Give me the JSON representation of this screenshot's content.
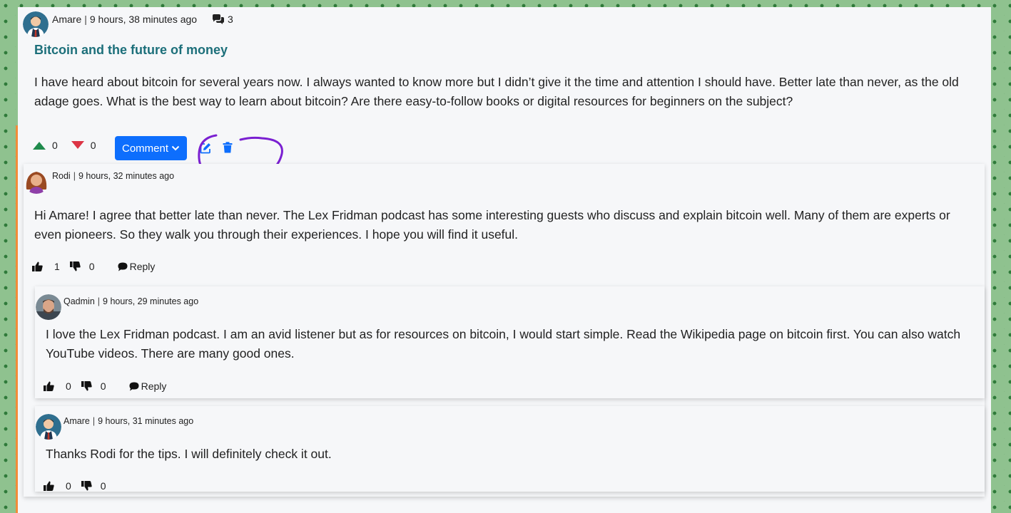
{
  "post": {
    "author": "Amare",
    "time": "9 hours, 38 minutes ago",
    "comment_count": "3",
    "title": "Bitcoin and the future of money",
    "body": "I have heard about bitcoin for several years now. I always wanted to know more but I didn’t give it the time and attention I should have. Better late than never, as the old adage goes. What is the best way to learn about bitcoin? Are there easy-to-follow books or digital resources for beginners on the subject?",
    "upvotes": "0",
    "downvotes": "0",
    "comment_button": "Comment",
    "colors": {
      "upvote": "#1f8a4c",
      "downvote": "#dc3545",
      "button": "#0d6efd",
      "title": "#1c6f7a",
      "annotation": "#7a1fd1"
    }
  },
  "comments": [
    {
      "author": "Rodi",
      "time": "9 hours, 32 minutes ago",
      "body": "Hi Amare! I agree that better late than never. The Lex Fridman podcast has some interesting guests who discuss and explain bitcoin well. Many of them are experts or even pioneers. So they walk you through their experiences. I hope you will find it useful.",
      "likes": "1",
      "dislikes": "0",
      "reply": "Reply"
    },
    {
      "author": "Qadmin",
      "time": "9 hours, 29 minutes ago",
      "body": "I love the Lex Fridman podcast. I am an avid listener but as for resources on bitcoin, I would start simple. Read the Wikipedia page on bitcoin first. You can also watch YouTube videos. There are many good ones.",
      "likes": "0",
      "dislikes": "0",
      "reply": "Reply"
    },
    {
      "author": "Amare",
      "time": "9 hours, 31 minutes ago",
      "body": "Thanks Rodi for the tips. I will definitely check it out.",
      "likes": "0",
      "dislikes": "0"
    }
  ]
}
